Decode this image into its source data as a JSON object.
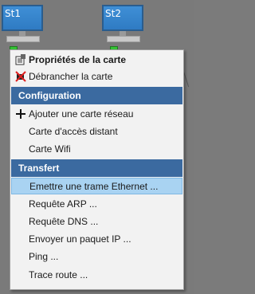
{
  "stations": [
    {
      "label": "St1"
    },
    {
      "label": "St2"
    }
  ],
  "menu": {
    "items_top": [
      {
        "label": "Propriétés de la carte",
        "icon": "properties-icon"
      },
      {
        "label": "Débrancher la carte",
        "icon": "unplug-icon"
      }
    ],
    "configuration": {
      "title": "Configuration",
      "items": [
        {
          "label": "Ajouter une carte réseau",
          "icon": "plus-icon"
        },
        {
          "label": "Carte d'accès distant"
        },
        {
          "label": "Carte Wifi"
        }
      ]
    },
    "transfert": {
      "title": "Transfert",
      "items": [
        {
          "label": "Emettre une trame Ethernet ..."
        },
        {
          "label": "Requête ARP ..."
        },
        {
          "label": "Requête DNS ..."
        },
        {
          "label": "Envoyer un paquet IP ..."
        },
        {
          "label": "Ping ..."
        },
        {
          "label": "Trace route ..."
        }
      ]
    }
  },
  "colors": {
    "section_bg": "#3b6aa0",
    "highlight_bg": "#a9d3f2",
    "monitor_blue": "#3f8fd6",
    "port_green": "#35c435"
  }
}
